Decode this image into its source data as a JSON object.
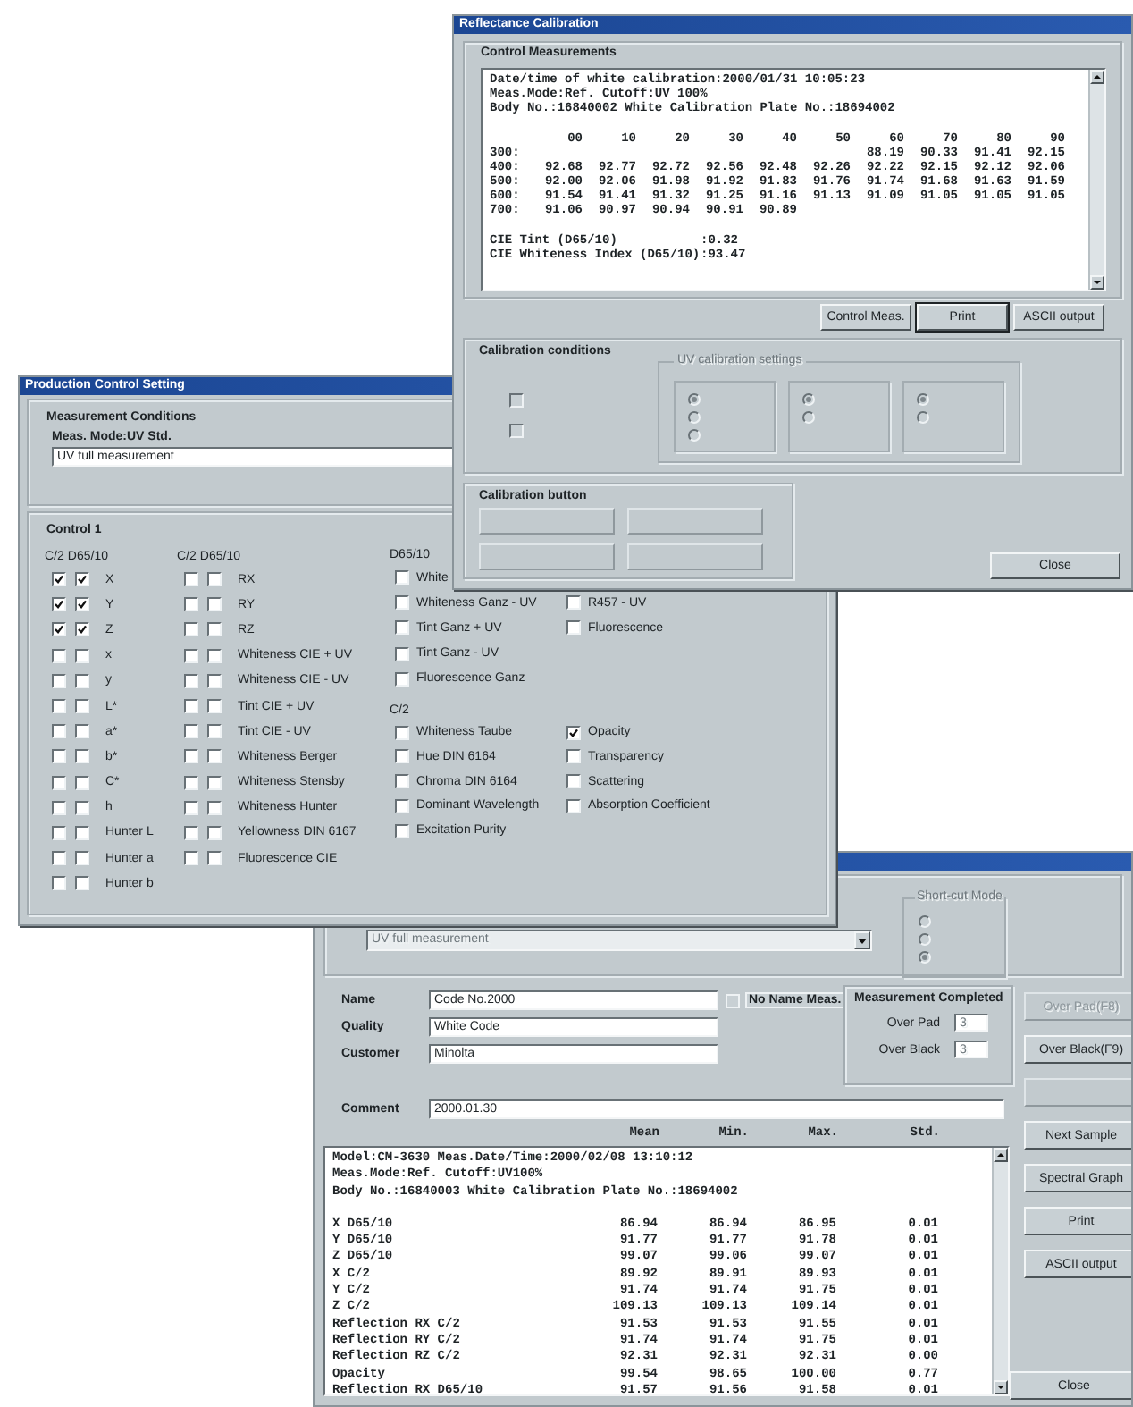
{
  "reflectance_calibration": {
    "title": "Reflectance Calibration",
    "control_measurements": {
      "legend": "Control Measurements",
      "header_lines": [
        "Date/time of white calibration:2000/01/31 10:05:23",
        "Meas.Mode:Ref. Cutoff:UV 100%",
        "Body No.:16840002 White Calibration Plate No.:18694002"
      ],
      "wavelength_header": [
        "00",
        "10",
        "20",
        "30",
        "40",
        "50",
        "60",
        "70",
        "80",
        "90"
      ],
      "rows": [
        {
          "label": "300:",
          "kind": "right_aligned",
          "values": [
            "88.19",
            "90.33",
            "91.41",
            "92.15"
          ]
        },
        {
          "label": "400:",
          "kind": "left_aligned",
          "values": [
            "92.68",
            "92.77",
            "92.72",
            "92.56",
            "92.48",
            "92.26",
            "92.22",
            "92.15",
            "92.12",
            "92.06"
          ]
        },
        {
          "label": "500:",
          "kind": "left_aligned",
          "values": [
            "92.00",
            "92.06",
            "91.98",
            "91.92",
            "91.83",
            "91.76",
            "91.74",
            "91.68",
            "91.63",
            "91.59"
          ]
        },
        {
          "label": "600:",
          "kind": "left_aligned",
          "values": [
            "91.54",
            "91.41",
            "91.32",
            "91.25",
            "91.16",
            "91.13",
            "91.09",
            "91.05",
            "91.05",
            "91.05"
          ]
        },
        {
          "label": "700:",
          "kind": "left_aligned",
          "values": [
            "91.06",
            "90.97",
            "90.94",
            "90.91",
            "90.89"
          ]
        }
      ],
      "summary": [
        {
          "label": "CIE Tint (D65/10)",
          "value": ":0.32"
        },
        {
          "label": "CIE Whiteness Index (D65/10)",
          "value": ":93.47"
        }
      ]
    },
    "buttons": [
      {
        "label": "Control Meas.",
        "focused": false
      },
      {
        "label": "Print",
        "focused": true
      },
      {
        "label": "ASCII output",
        "focused": false
      }
    ],
    "calibration_conditions": {
      "legend": "Calibration conditions",
      "uv_settings_legend": "UV calibration settings",
      "checkboxes": [
        {
          "checked": false,
          "disabled": true
        },
        {
          "checked": false,
          "disabled": true
        }
      ],
      "radio_groups": [
        {
          "options": [
            {
              "selected": true
            },
            {
              "selected": false
            },
            {
              "selected": false
            }
          ]
        },
        {
          "options": [
            {
              "selected": true
            },
            {
              "selected": false
            }
          ]
        },
        {
          "options": [
            {
              "selected": true
            },
            {
              "selected": false
            }
          ]
        }
      ]
    },
    "calibration_button": {
      "legend": "Calibration button",
      "buttons": [
        {
          "disabled": true
        },
        {
          "disabled": true
        },
        {
          "disabled": true
        },
        {
          "disabled": true
        }
      ]
    },
    "close_button": "Close"
  },
  "production_control_setting": {
    "title": "Production Control Setting",
    "measurement_conditions": {
      "legend": "Measurement Conditions",
      "mode_label": "Meas. Mode:UV Std.",
      "mode_value": "UV full measurement"
    },
    "control": {
      "legend": "Control 1",
      "columns": [
        {
          "kind": "double",
          "headers": [
            "C/2",
            "D65/10"
          ],
          "items": [
            {
              "label": "X",
              "checks": [
                {
                  "checked": true
                },
                {
                  "checked": true
                }
              ]
            },
            {
              "label": "Y",
              "checks": [
                {
                  "checked": true
                },
                {
                  "checked": true
                }
              ]
            },
            {
              "label": "Z",
              "checks": [
                {
                  "checked": true
                },
                {
                  "checked": true
                }
              ]
            },
            {
              "label": "x",
              "checks": [
                {
                  "checked": false
                },
                {
                  "checked": false
                }
              ]
            },
            {
              "label": "y",
              "checks": [
                {
                  "checked": false
                },
                {
                  "checked": false
                }
              ]
            },
            {
              "label": "L*",
              "checks": [
                {
                  "checked": false
                },
                {
                  "checked": false
                }
              ]
            },
            {
              "label": "a*",
              "checks": [
                {
                  "checked": false
                },
                {
                  "checked": false
                }
              ]
            },
            {
              "label": "b*",
              "checks": [
                {
                  "checked": false
                },
                {
                  "checked": false
                }
              ]
            },
            {
              "label": "C*",
              "checks": [
                {
                  "checked": false
                },
                {
                  "checked": false
                }
              ]
            },
            {
              "label": "h",
              "checks": [
                {
                  "checked": false
                },
                {
                  "checked": false
                }
              ]
            },
            {
              "label": "Hunter L",
              "checks": [
                {
                  "checked": false
                },
                {
                  "checked": false
                }
              ]
            },
            {
              "label": "Hunter a",
              "checks": [
                {
                  "checked": false
                },
                {
                  "checked": false
                }
              ]
            },
            {
              "label": "Hunter b",
              "checks": [
                {
                  "checked": false
                },
                {
                  "checked": false
                }
              ]
            }
          ]
        },
        {
          "kind": "double",
          "headers": [
            "C/2",
            "D65/10"
          ],
          "items": [
            {
              "label": "RX",
              "checks": [
                {
                  "checked": false
                },
                {
                  "checked": false
                }
              ]
            },
            {
              "label": "RY",
              "checks": [
                {
                  "checked": false
                },
                {
                  "checked": false
                }
              ]
            },
            {
              "label": "RZ",
              "checks": [
                {
                  "checked": false
                },
                {
                  "checked": false
                }
              ]
            },
            {
              "label": "Whiteness CIE + UV",
              "checks": [
                {
                  "checked": false
                },
                {
                  "checked": false
                }
              ]
            },
            {
              "label": "Whiteness CIE - UV",
              "checks": [
                {
                  "checked": false
                },
                {
                  "checked": false
                }
              ]
            },
            {
              "label": "Tint CIE + UV",
              "checks": [
                {
                  "checked": false
                },
                {
                  "checked": false
                }
              ]
            },
            {
              "label": "Tint CIE - UV",
              "checks": [
                {
                  "checked": false
                },
                {
                  "checked": false
                }
              ]
            },
            {
              "label": "Whiteness Berger",
              "checks": [
                {
                  "checked": false
                },
                {
                  "checked": false
                }
              ]
            },
            {
              "label": "Whiteness Stensby",
              "checks": [
                {
                  "checked": false
                },
                {
                  "checked": false
                }
              ]
            },
            {
              "label": "Whiteness Hunter",
              "checks": [
                {
                  "checked": false
                },
                {
                  "checked": false
                }
              ]
            },
            {
              "label": "Yellowness DIN 6167",
              "checks": [
                {
                  "checked": false
                },
                {
                  "checked": false
                }
              ]
            },
            {
              "label": "Fluorescence CIE",
              "checks": [
                {
                  "checked": false
                },
                {
                  "checked": false
                }
              ]
            }
          ]
        },
        {
          "kind": "blocks",
          "blocks": [
            {
              "header": "D65/10",
              "columns": [
                {
                  "kind": "from_first_row",
                  "items": [
                    {
                      "label": "White",
                      "checked": false
                    },
                    {
                      "label": "Whiteness Ganz - UV",
                      "checked": false
                    },
                    {
                      "label": "Tint Ganz + UV",
                      "checked": false
                    },
                    {
                      "label": "Tint Ganz - UV",
                      "checked": false
                    },
                    {
                      "label": "Fluorescence Ganz",
                      "checked": false
                    }
                  ]
                },
                {
                  "kind": "from_second_row",
                  "items": [
                    {
                      "label": "R457 - UV",
                      "checked": false
                    },
                    {
                      "label": "Fluorescence",
                      "checked": false
                    }
                  ]
                }
              ]
            },
            {
              "header": "C/2",
              "columns": [
                {
                  "kind": "from_first_row",
                  "items": [
                    {
                      "label": "Whiteness Taube",
                      "checked": false
                    },
                    {
                      "label": "Hue DIN 6164",
                      "checked": false
                    },
                    {
                      "label": "Chroma DIN 6164",
                      "checked": false
                    },
                    {
                      "label": "Dominant Wavelength",
                      "checked": false
                    },
                    {
                      "label": "Excitation Purity",
                      "checked": false
                    }
                  ]
                },
                {
                  "kind": "from_first_row",
                  "items": [
                    {
                      "label": "Opacity",
                      "checked": true
                    },
                    {
                      "label": "Transparency",
                      "checked": false
                    },
                    {
                      "label": "Scattering",
                      "checked": false
                    },
                    {
                      "label": "Absorption Coefficient",
                      "checked": false
                    }
                  ]
                }
              ]
            }
          ]
        }
      ]
    }
  },
  "measurement_window": {
    "mode_field": {
      "value": "UV full measurement",
      "disabled": true
    },
    "short_cut_mode": {
      "legend": "Short-cut Mode",
      "options": [
        {
          "selected": false
        },
        {
          "selected": false
        },
        {
          "selected": true
        }
      ]
    },
    "fields": [
      {
        "label": "Name",
        "value": "Code No.2000"
      },
      {
        "label": "Quality",
        "value": "White Code"
      },
      {
        "label": "Customer",
        "value": "Minolta"
      },
      {
        "label": "Comment",
        "value": "2000.01.30"
      }
    ],
    "no_name_meas": {
      "label": "No Name Meas.",
      "checked": false
    },
    "measurement_completed": {
      "legend": "Measurement Completed",
      "counters": [
        {
          "label": "Over Pad",
          "value": "3"
        },
        {
          "label": "Over Black",
          "value": "3"
        }
      ]
    },
    "results": {
      "columns": [
        "Mean",
        "Min.",
        "Max.",
        "Std."
      ],
      "header_lines": [
        "Model:CM-3630 Meas.Date/Time:2000/02/08 13:10:12",
        "Meas.Mode:Ref. Cutoff:UV100%",
        "Body No.:16840003 White Calibration Plate No.:18694002"
      ],
      "rows": [
        {
          "label": "X D65/10",
          "values": [
            "86.94",
            "86.94",
            "86.95",
            "0.01"
          ]
        },
        {
          "label": "Y D65/10",
          "values": [
            "91.77",
            "91.77",
            "91.78",
            "0.01"
          ]
        },
        {
          "label": "Z D65/10",
          "values": [
            "99.07",
            "99.06",
            "99.07",
            "0.01"
          ]
        },
        {
          "label": "X C/2",
          "values": [
            "89.92",
            "89.91",
            "89.93",
            "0.01"
          ]
        },
        {
          "label": "Y C/2",
          "values": [
            "91.74",
            "91.74",
            "91.75",
            "0.01"
          ]
        },
        {
          "label": "Z C/2",
          "values": [
            "109.13",
            "109.13",
            "109.14",
            "0.01"
          ]
        },
        {
          "label": "Reflection RX C/2",
          "values": [
            "91.53",
            "91.53",
            "91.55",
            "0.01"
          ]
        },
        {
          "label": "Reflection RY C/2",
          "values": [
            "91.74",
            "91.74",
            "91.75",
            "0.01"
          ]
        },
        {
          "label": "Reflection RZ C/2",
          "values": [
            "92.31",
            "92.31",
            "92.31",
            "0.00"
          ]
        },
        {
          "label": "Opacity",
          "values": [
            "99.54",
            "98.65",
            "100.00",
            "0.77"
          ]
        },
        {
          "label": "Reflection RX D65/10",
          "values": [
            "91.57",
            "91.56",
            "91.58",
            "0.01"
          ]
        }
      ]
    },
    "side_buttons": [
      {
        "label": "Over Pad(F8)",
        "disabled": true
      },
      {
        "label": "Over Black(F9)",
        "disabled": false
      },
      {
        "disabled": true
      },
      {
        "label": "Next Sample",
        "disabled": false
      },
      {
        "label": "Spectral Graph",
        "disabled": false
      },
      {
        "label": "Print",
        "disabled": false
      },
      {
        "label": "ASCII output",
        "disabled": false
      }
    ],
    "close_button": "Close"
  }
}
